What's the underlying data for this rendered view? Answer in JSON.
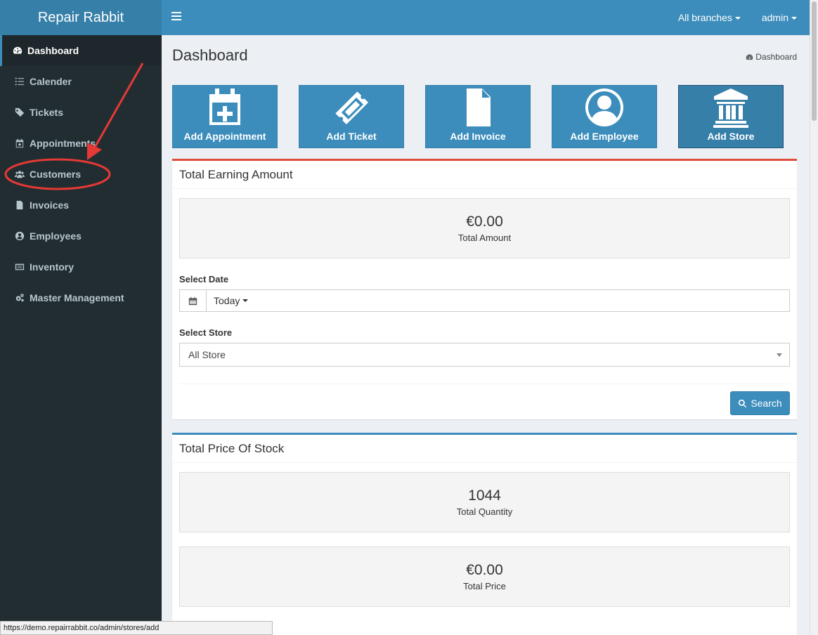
{
  "app": {
    "title": "Repair Rabbit"
  },
  "header": {
    "branches": "All branches",
    "user": "admin"
  },
  "sidebar": {
    "items": [
      {
        "label": "Dashboard",
        "icon": "dashboard-icon"
      },
      {
        "label": "Calender",
        "icon": "list-icon"
      },
      {
        "label": "Tickets",
        "icon": "tag-icon"
      },
      {
        "label": "Appointments",
        "icon": "calendar-icon"
      },
      {
        "label": "Customers",
        "icon": "users-icon"
      },
      {
        "label": "Invoices",
        "icon": "file-icon"
      },
      {
        "label": "Employees",
        "icon": "user-circle-icon"
      },
      {
        "label": "Inventory",
        "icon": "inventory-icon"
      },
      {
        "label": "Master Management",
        "icon": "gears-icon"
      }
    ]
  },
  "page": {
    "title": "Dashboard",
    "breadcrumb": "Dashboard"
  },
  "quick_actions": [
    {
      "label": "Add Appointment",
      "icon": "calendar-plus-icon"
    },
    {
      "label": "Add Ticket",
      "icon": "ticket-icon"
    },
    {
      "label": "Add Invoice",
      "icon": "document-icon"
    },
    {
      "label": "Add Employee",
      "icon": "user-icon"
    },
    {
      "label": "Add Store",
      "icon": "bank-icon"
    }
  ],
  "earnings": {
    "title": "Total Earning Amount",
    "amount": "€0.00",
    "amount_label": "Total Amount",
    "date_label": "Select Date",
    "date_value": "Today",
    "store_label": "Select Store",
    "store_value": "All Store",
    "search_label": "Search"
  },
  "stock": {
    "title": "Total Price Of Stock",
    "quantity": "1044",
    "quantity_label": "Total Quantity",
    "price": "€0.00",
    "price_label": "Total Price"
  },
  "status_url": "https://demo.repairrabbit.co/admin/stores/add",
  "colors": {
    "header": "#3c8dbc",
    "sidebar": "#222d32",
    "annotation": "#e53935"
  }
}
